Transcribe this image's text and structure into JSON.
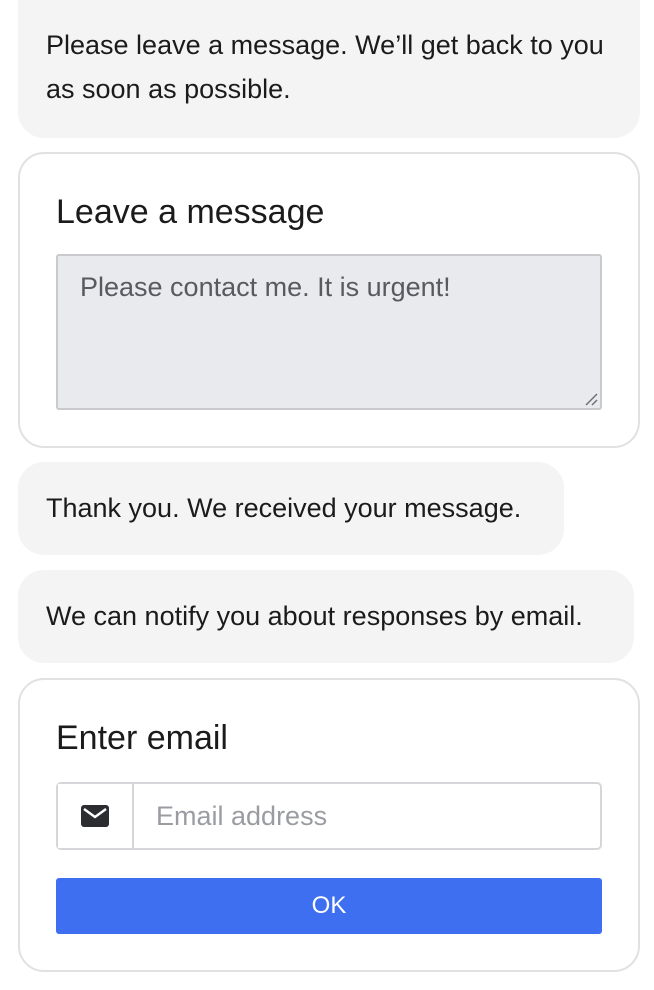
{
  "messages": [
    {
      "text": "Please leave a message. We’ll get back to you as soon as possible."
    },
    {
      "text": "Thank you. We received your message."
    },
    {
      "text": "We can notify you about responses by email."
    }
  ],
  "message_form": {
    "title": "Leave a message",
    "value": "Please contact me. It is urgent!"
  },
  "email_form": {
    "title": "Enter email",
    "icon": "envelope-icon",
    "placeholder": "Email address",
    "ok_label": "OK"
  },
  "colors": {
    "bubble": "#f4f4f5",
    "button": "#3d6ff0",
    "textarea_bg": "#e9eaed"
  }
}
